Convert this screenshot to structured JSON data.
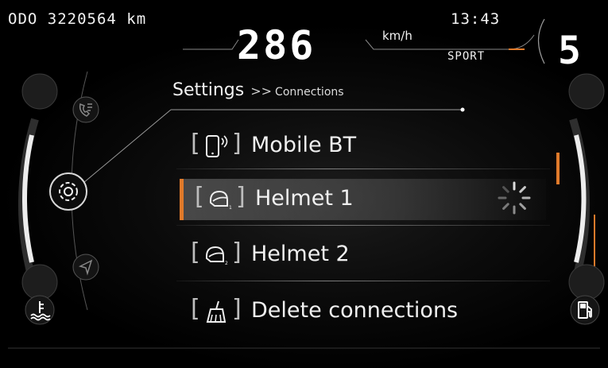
{
  "status": {
    "odometer": "ODO 3220564 km",
    "clock": "13:43",
    "speed": "286",
    "speed_unit": "km/h",
    "ride_mode": "SPORT",
    "gear": "5"
  },
  "header": {
    "title": "Settings",
    "separator": ">>",
    "breadcrumb": "Connections"
  },
  "menu": {
    "items": [
      {
        "label": "Mobile BT",
        "icon": "phone-bluetooth-icon",
        "selected": false
      },
      {
        "label": "Helmet 1",
        "icon": "helmet-1-icon",
        "selected": true,
        "status": "connecting-spinner"
      },
      {
        "label": "Helmet 2",
        "icon": "helmet-2-icon",
        "selected": false
      },
      {
        "label": "Delete connections",
        "icon": "broom-icon",
        "selected": false
      }
    ]
  },
  "side_menu": {
    "icons": [
      "phone-call-icon",
      "settings-gear-icon",
      "navigation-icon"
    ],
    "active": "settings-gear-icon"
  },
  "gauges": {
    "left_icon": "coolant-temperature-icon",
    "right_icon": "fuel-pump-icon"
  },
  "colors": {
    "accent": "#e07a2a",
    "text": "#f0f0f0",
    "background": "#000000"
  }
}
